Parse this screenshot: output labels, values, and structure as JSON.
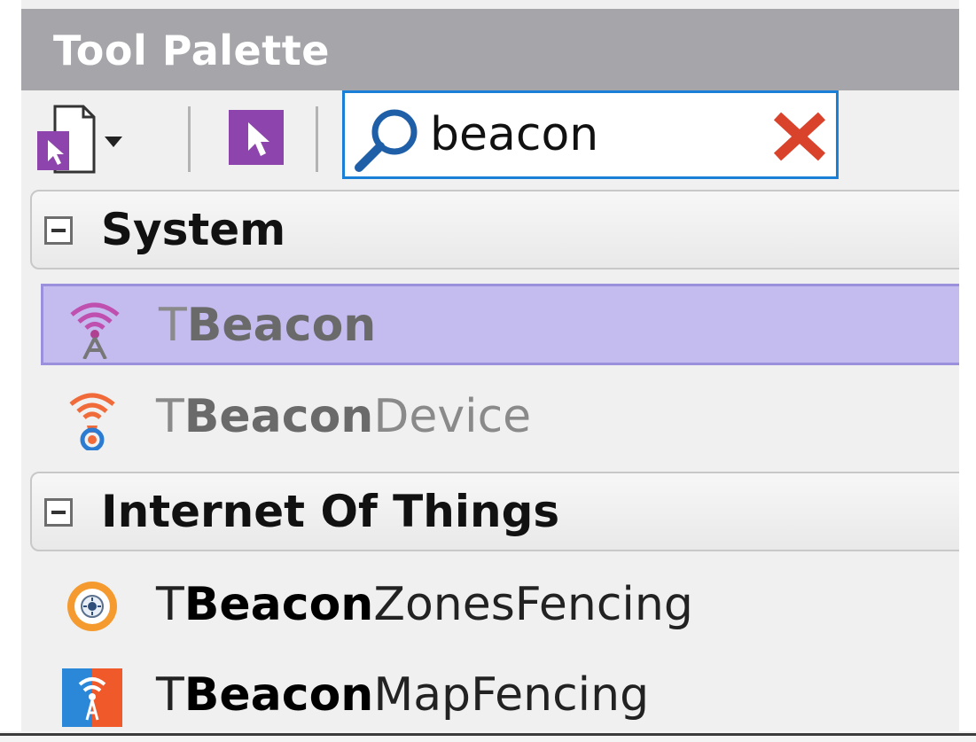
{
  "palette": {
    "title": "Tool Palette",
    "search": {
      "value": "beacon",
      "placeholder": ""
    },
    "categories": [
      {
        "label": "System",
        "items": [
          {
            "prefix": "T",
            "match": "Beacon",
            "suffix": "",
            "selected": true,
            "dimmed": true,
            "icon": "beacon-tower-icon"
          },
          {
            "prefix": "T",
            "match": "Beacon",
            "suffix": "Device",
            "selected": false,
            "dimmed": true,
            "icon": "beacon-device-icon"
          }
        ]
      },
      {
        "label": "Internet Of Things",
        "items": [
          {
            "prefix": "T",
            "match": "Beacon",
            "suffix": "ZonesFencing",
            "selected": false,
            "dimmed": false,
            "icon": "zones-fencing-icon"
          },
          {
            "prefix": "T",
            "match": "Beacon",
            "suffix": "MapFencing",
            "selected": false,
            "dimmed": false,
            "icon": "map-fencing-icon"
          }
        ]
      }
    ]
  },
  "colors": {
    "title_bar": "#a6a5aa",
    "selection": "#c4bcef",
    "search_border": "#1a7fd6",
    "clear_red": "#d9432b",
    "tool_purple": "#8e44ad"
  }
}
